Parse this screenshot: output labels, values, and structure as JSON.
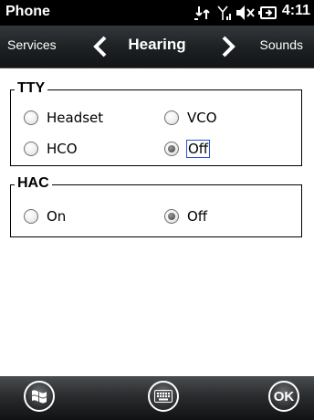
{
  "status_bar": {
    "app_title": "Phone",
    "time": "4:11",
    "icons": [
      "data-transfer-icon",
      "signal-strength-icon",
      "speaker-muted-icon",
      "battery-charging-icon"
    ]
  },
  "nav": {
    "prev_label": "Services",
    "title": "Hearing",
    "next_label": "Sounds"
  },
  "groups": {
    "tty": {
      "label": "TTY",
      "options": [
        {
          "label": "Headset",
          "selected": false
        },
        {
          "label": "VCO",
          "selected": false
        },
        {
          "label": "HCO",
          "selected": false
        },
        {
          "label": "Off",
          "selected": true,
          "focused": true
        }
      ]
    },
    "hac": {
      "label": "HAC",
      "options": [
        {
          "label": "On",
          "selected": false
        },
        {
          "label": "Off",
          "selected": true
        }
      ]
    }
  },
  "bottom_bar": {
    "buttons": [
      "start-windows-icon",
      "keyboard-icon",
      "ok-button"
    ],
    "ok_label": "OK"
  },
  "colors": {
    "status_bar_bg": "#000000",
    "nav_bar_bg": "#1d2023",
    "focus_outline": "#2b4fd8",
    "content_bg": "#ffffff"
  }
}
